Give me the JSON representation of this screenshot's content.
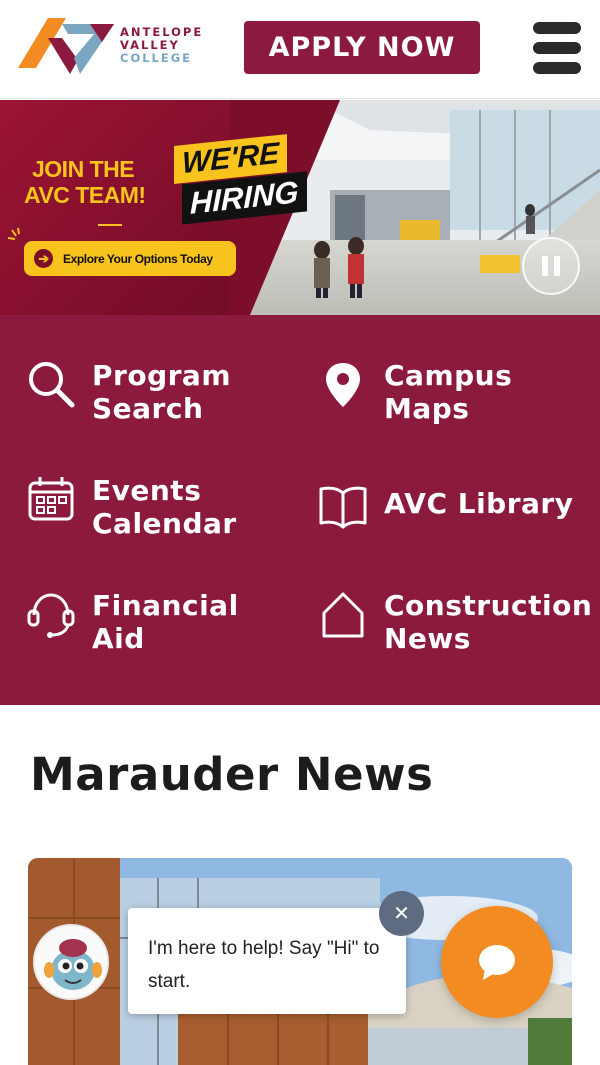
{
  "header": {
    "logo": {
      "line1": "ANTELOPE",
      "line2": "VALLEY",
      "line3": "COLLEGE",
      "colors": {
        "orange": "#f28b22",
        "maroon": "#8c1a3f",
        "blue": "#7aa6c2"
      }
    },
    "apply_label": "APPLY NOW",
    "menu_icon": "hamburger-menu-icon"
  },
  "hero": {
    "join_line1": "JOIN THE",
    "join_line2": "AVC TEAM!",
    "hiring_line1": "WE'RE",
    "hiring_line2": "HIRING",
    "explore_label": "Explore Your Options Today",
    "pause_icon": "pause-icon",
    "colors": {
      "maroon": "#8a1230",
      "gold": "#f7c31c"
    }
  },
  "quick_links": {
    "background": "#8b1a3d",
    "items": [
      {
        "label": "Program\nSearch",
        "icon": "search-icon"
      },
      {
        "label": "Campus\nMaps",
        "icon": "map-pin-icon"
      },
      {
        "label": "Events\nCalendar",
        "icon": "calendar-icon"
      },
      {
        "label": "AVC Library",
        "icon": "book-icon"
      },
      {
        "label": "Financial\nAid",
        "icon": "headset-icon"
      },
      {
        "label": "Construction\nNews",
        "icon": "house-icon"
      }
    ]
  },
  "news": {
    "title": "Marauder News"
  },
  "chat": {
    "message": "I'm here to help! Say \"Hi\" to start.",
    "close_icon": "close-icon",
    "launcher_icon": "chat-bubble-icon",
    "launcher_color": "#f28b22"
  }
}
